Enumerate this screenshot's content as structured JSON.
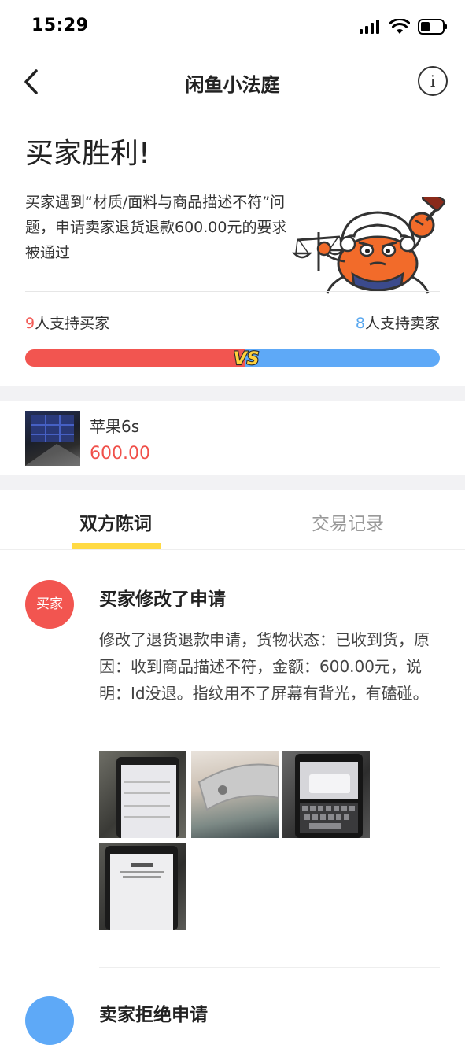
{
  "status_bar": {
    "time": "15:29"
  },
  "nav": {
    "title": "闲鱼小法庭",
    "info_glyph": "i"
  },
  "verdict": {
    "title": "买家胜利!",
    "description": "买家遇到“材质/面料与商品描述不符”问题，申请卖家退货退款600.00元的要求被通过"
  },
  "support": {
    "buyer_count": "9",
    "buyer_text": "人支持买家",
    "seller_count": "8",
    "seller_text": "人支持卖家",
    "buyer_share": 0.53,
    "vs_label": "VS"
  },
  "product": {
    "name": "苹果6s",
    "price": "600.00"
  },
  "tabs": [
    {
      "label": "双方陈词",
      "active": true
    },
    {
      "label": "交易记录",
      "active": false
    }
  ],
  "entry": {
    "avatar_label": "买家",
    "title": "买家修改了申请",
    "body": "修改了退货退款申请，货物状态：已收到货，原因：收到商品描述不符，金额：600.00元，说明：Id没退。指纹用不了屏幕有背光，有磕碰。",
    "photo_count": 4
  },
  "next_entry": {
    "title": "卖家拒绝申请"
  },
  "colors": {
    "buyer": "#f25550",
    "seller": "#5ea9f7",
    "price": "#f0504a",
    "tab_underline": "#ffda44",
    "section_gap": "#f2f2f4"
  },
  "icons": [
    "cellular-signal-icon",
    "wifi-icon",
    "battery-icon",
    "back-arrow-icon",
    "info-icon",
    "crab-judge-mascot",
    "vs-badge"
  ]
}
